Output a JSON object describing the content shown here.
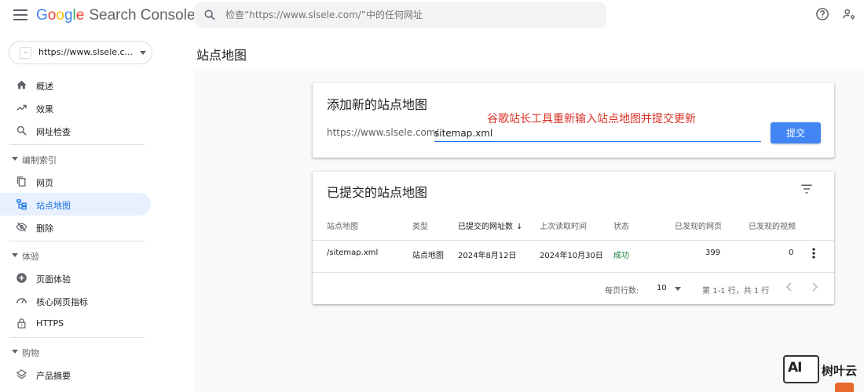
{
  "header": {
    "logo_google": [
      "G",
      "o",
      "o",
      "g",
      "l",
      "e"
    ],
    "product": "Search Console",
    "search_placeholder": "检查“https://www.slsele.com/”中的任何网址"
  },
  "sidebar": {
    "property_url": "https://www.slsele.c...",
    "items": [
      {
        "label": "概述",
        "icon": "home-icon"
      },
      {
        "label": "效果",
        "icon": "trending-up-icon"
      },
      {
        "label": "网址检查",
        "icon": "search-icon"
      }
    ],
    "section_index": "编制索引",
    "index_items": [
      {
        "label": "网页",
        "icon": "pages-icon"
      },
      {
        "label": "站点地图",
        "icon": "sitemap-icon"
      },
      {
        "label": "删除",
        "icon": "removal-icon"
      }
    ],
    "section_experience": "体验",
    "experience_items": [
      {
        "label": "页面体验",
        "icon": "page-experience-icon"
      },
      {
        "label": "核心网页指标",
        "icon": "speed-icon"
      },
      {
        "label": "HTTPS",
        "icon": "lock-icon"
      }
    ],
    "section_shopping": "购物",
    "shopping_items": [
      {
        "label": "产品摘要",
        "icon": "layers-icon"
      }
    ]
  },
  "page": {
    "title": "站点地图"
  },
  "add_card": {
    "title": "添加新的站点地图",
    "annotation": "谷歌站长工具重新输入站点地图并提交更新",
    "prefix": "https://www.slsele.com/",
    "input_value": "sitemap.xml",
    "submit_label": "提交"
  },
  "submitted_card": {
    "title": "已提交的站点地图",
    "columns": [
      "站点地图",
      "类型",
      "已提交的网址数",
      "上次读取时间",
      "状态",
      "已发现的网页",
      "已发现的视频"
    ],
    "sort_indicator": "↓",
    "rows": [
      {
        "sitemap": "/sitemap.xml",
        "type": "站点地图",
        "submitted": "2024年8月12日",
        "last_read": "2024年10月30日",
        "status": "成功",
        "pages": "399",
        "videos": "0"
      }
    ],
    "pagination": {
      "rows_per_page_label": "每页行数:",
      "rows_per_page": "10",
      "range": "第 1-1 行，共 1 行"
    }
  },
  "watermark": {
    "logo_text": "AI",
    "name": "树叶云"
  },
  "colors": {
    "accent": "#1a73e8",
    "button": "#4285f4",
    "success": "#188038",
    "annotation": "#d93025"
  }
}
